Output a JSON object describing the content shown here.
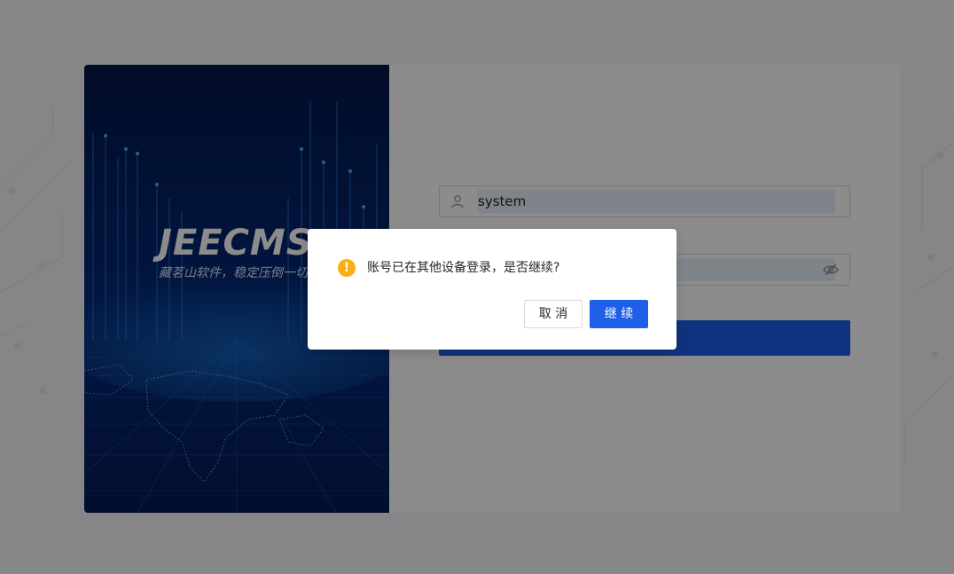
{
  "banner": {
    "brand": "JEECMS",
    "slogan": "藏茗山软件，稳定压倒一切"
  },
  "login_form": {
    "username_value": "system",
    "password_value": "",
    "icons": {
      "user": "user-icon",
      "password_visibility": "eye-off-icon"
    }
  },
  "dialog": {
    "icon": "warning-icon",
    "message": "账号已在其他设备登录，是否继续?",
    "cancel_label": "取 消",
    "confirm_label": "继 续"
  },
  "colors": {
    "primary": "#1e5ee8",
    "warning": "#faad14",
    "banner_bg": "#031b55"
  }
}
